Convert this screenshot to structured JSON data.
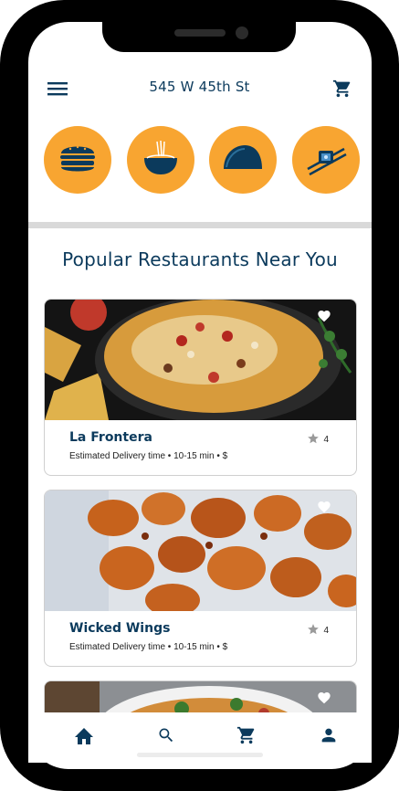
{
  "header": {
    "address": "545 W 45th St",
    "menu_icon": "menu-icon",
    "cart_icon": "cart-icon"
  },
  "categories": [
    {
      "icon": "burger-icon"
    },
    {
      "icon": "noodle-bowl-icon"
    },
    {
      "icon": "taco-icon"
    },
    {
      "icon": "sushi-chopsticks-icon"
    }
  ],
  "section": {
    "title": "Popular Restaurants Near You"
  },
  "restaurants": [
    {
      "name": "La Frontera",
      "meta": "Estimated Delivery time • 10-15 min • $",
      "rating": "4"
    },
    {
      "name": "Wicked Wings",
      "meta": "Estimated Delivery time • 10-15 min • $",
      "rating": "4"
    }
  ],
  "bottom_nav": [
    {
      "icon": "home-icon"
    },
    {
      "icon": "search-icon"
    },
    {
      "icon": "cart-icon"
    },
    {
      "icon": "profile-icon"
    }
  ],
  "colors": {
    "accent": "#f8a531",
    "primary": "#0b3a5c"
  }
}
